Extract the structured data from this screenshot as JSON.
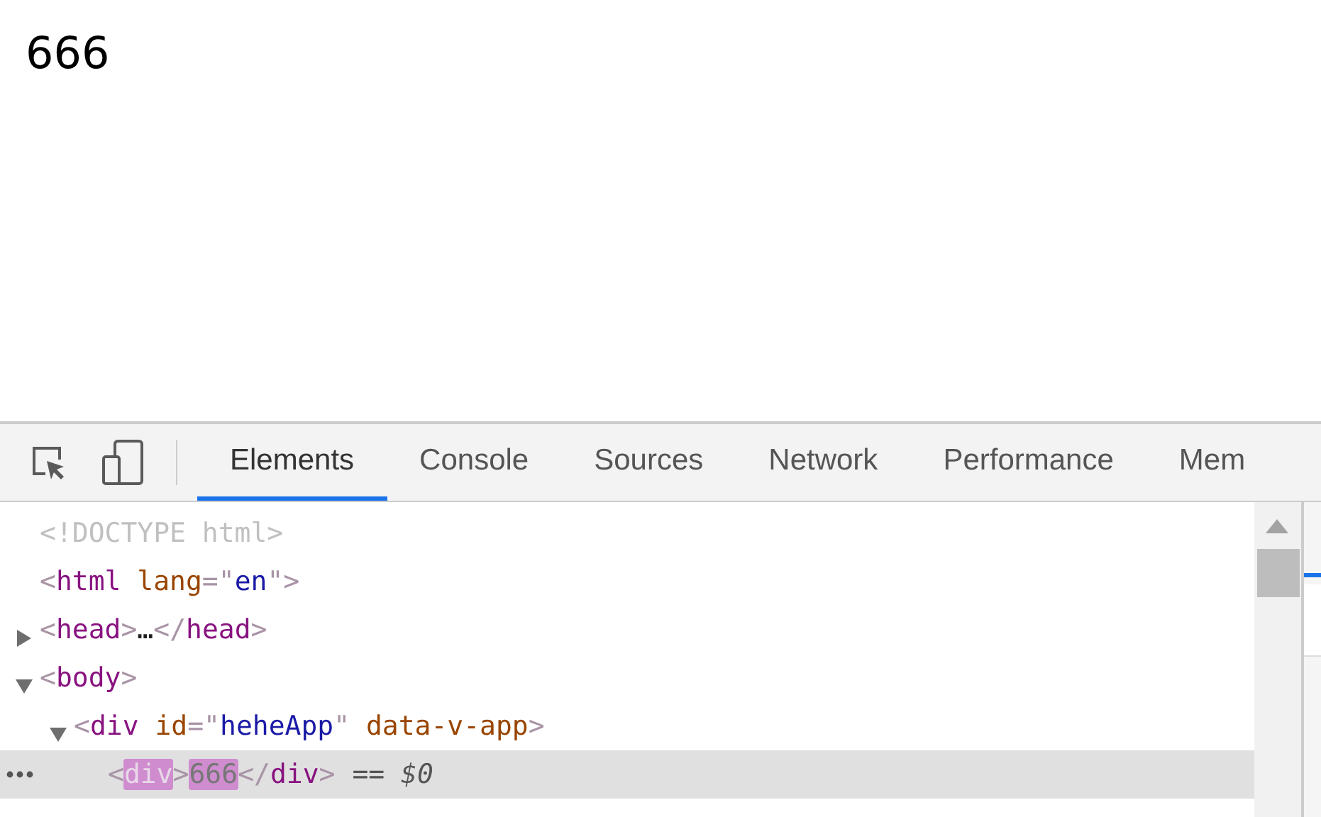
{
  "page": {
    "text": "666"
  },
  "devtools": {
    "tabs": [
      {
        "label": "Elements",
        "selected": true
      },
      {
        "label": "Console",
        "selected": false
      },
      {
        "label": "Sources",
        "selected": false
      },
      {
        "label": "Network",
        "selected": false
      },
      {
        "label": "Performance",
        "selected": false
      },
      {
        "label": "Mem",
        "selected": false
      }
    ],
    "tree": [
      {
        "selected": false,
        "tokens": [
          {
            "kind": "doctype",
            "text": "<!DOCTYPE html>"
          }
        ]
      },
      {
        "selected": false,
        "tokens": [
          {
            "kind": "punct",
            "text": "<"
          },
          {
            "kind": "tag",
            "text": "html"
          },
          {
            "kind": "attr",
            "text": " lang"
          },
          {
            "kind": "punct",
            "text": "=\""
          },
          {
            "kind": "value",
            "text": "en"
          },
          {
            "kind": "punct",
            "text": "\">"
          }
        ]
      },
      {
        "selected": false,
        "expanded": false,
        "tokens": [
          {
            "kind": "punct",
            "text": "<"
          },
          {
            "kind": "tag",
            "text": "head"
          },
          {
            "kind": "punct",
            "text": ">"
          },
          {
            "kind": "text",
            "text": "…"
          },
          {
            "kind": "punct",
            "text": "</"
          },
          {
            "kind": "tag",
            "text": "head"
          },
          {
            "kind": "punct",
            "text": ">"
          }
        ]
      },
      {
        "selected": false,
        "expanded": true,
        "tokens": [
          {
            "kind": "punct",
            "text": "<"
          },
          {
            "kind": "tag",
            "text": "body"
          },
          {
            "kind": "punct",
            "text": ">"
          }
        ],
        "children": [
          {
            "selected": false,
            "expanded": true,
            "tokens": [
              {
                "kind": "punct",
                "text": "<"
              },
              {
                "kind": "tag",
                "text": "div"
              },
              {
                "kind": "attr",
                "text": " id"
              },
              {
                "kind": "punct",
                "text": "=\""
              },
              {
                "kind": "value",
                "text": "heheApp"
              },
              {
                "kind": "punct",
                "text": "\""
              },
              {
                "kind": "attr",
                "text": " data-v-app"
              },
              {
                "kind": "punct",
                "text": ">"
              }
            ],
            "children": [
              {
                "selected": true,
                "tokens": [
                  {
                    "kind": "punct",
                    "text": "<"
                  },
                  {
                    "kind": "tag",
                    "text": "div",
                    "highlighted": true
                  },
                  {
                    "kind": "punct",
                    "text": ">"
                  },
                  {
                    "kind": "text",
                    "text": "666",
                    "highlighted": true
                  },
                  {
                    "kind": "punct",
                    "text": "</"
                  },
                  {
                    "kind": "tag",
                    "text": "div"
                  },
                  {
                    "kind": "punct",
                    "text": ">"
                  }
                ],
                "note": "== $0"
              }
            ]
          }
        ]
      }
    ]
  }
}
